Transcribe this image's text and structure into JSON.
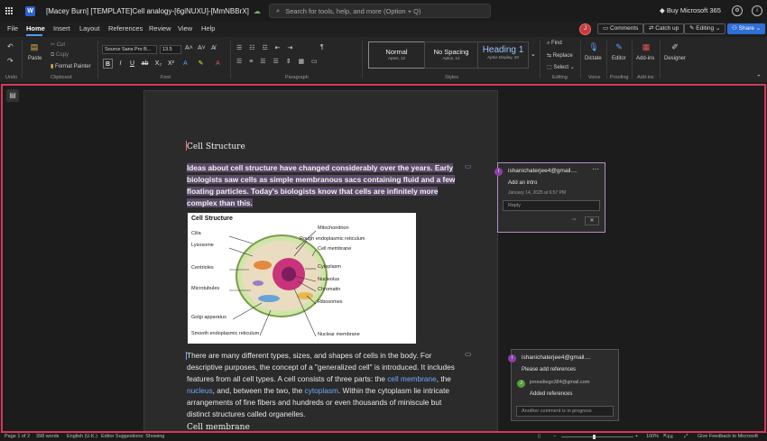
{
  "titlebar": {
    "doc_title": "[Macey Burn] [TEMPLATE]Cell analogy-[6giNUXU]-[MmNBBrX]",
    "search_placeholder": "Search for tools, help, and more (Option + Q)",
    "buy": "Buy Microsoft 365"
  },
  "menu": {
    "items": [
      "File",
      "Home",
      "Insert",
      "Layout",
      "References",
      "Review",
      "View",
      "Help"
    ],
    "active": "Home",
    "user_initial": "J",
    "comments": "Comments",
    "catchup": "Catch up",
    "editing": "Editing",
    "share": "Share"
  },
  "ribbon": {
    "undo_label": "Undo",
    "paste": "Paste",
    "cut": "Cut",
    "copy": "Copy",
    "format_painter": "Format Painter",
    "clipboard": "Clipboard",
    "font_name": "Source Sans Pro B...",
    "font_size": "13.5",
    "font_group": "Font",
    "paragraph_group": "Paragraph",
    "styles": [
      {
        "name": "Normal",
        "sub": "Aptos, 12"
      },
      {
        "name": "No Spacing",
        "sub": "Aptos, 12"
      },
      {
        "name": "Heading 1",
        "sub": "Aptos Display, 20"
      }
    ],
    "styles_group": "Styles",
    "find": "Find",
    "replace": "Replace",
    "select": "Select",
    "editing_group": "Editing",
    "dictate": "Dictate",
    "voice_group": "Voice",
    "editor": "Editor",
    "proofing_group": "Proofing",
    "addins": "Add-ins",
    "addins_group": "Add-ins",
    "designer": "Designer"
  },
  "document": {
    "heading1": "Cell Structure",
    "para1": "Ideas about cell structure have changed considerably over the years. Early biologists saw cells as simple membranous sacs containing fluid and a few floating particles. Today's biologists know that cells are infinitely more complex than this.",
    "figure_title": "Cell Structure",
    "figure_labels_left": [
      "Cilia",
      "Lysosome",
      "Centrioles",
      "Microtubules",
      "Golgi apparatus",
      "Smooth endoplasmic reticulum"
    ],
    "figure_labels_right": [
      "Mitochondrion",
      "Rough endoplasmic reticulum",
      "Cell membrane",
      "Cytoplasm",
      "Nucleolus",
      "Chromatin",
      "Ribosomes",
      "Nuclear membrane"
    ],
    "para2_a": "There are many different types, sizes, and shapes of cells in the body. For descriptive purposes, the concept of a \"generalized cell\" is introduced. It includes features from all cell types. A cell consists of three parts: the ",
    "para2_link1": "cell membrane",
    "para2_b": ", the ",
    "para2_link2": "nucleus",
    "para2_c": ", and, between the two, the ",
    "para2_link3": "cytoplasm",
    "para2_d": ". Within the cytoplasm lie intricate arrangements of fine fibers and hundreds or even thousands of miniscule but distinct structures called organelles.",
    "heading2": "Cell membrane"
  },
  "comments": [
    {
      "user": "ishanichaterjee4@gmail....",
      "initial": "I",
      "text": "Add an intro",
      "date": "January 14, 2025 at 6:57 PM",
      "reply_placeholder": "Reply"
    },
    {
      "user": "ishanichaterjee4@gmail....",
      "initial": "I",
      "text": "Please add references",
      "reply_user": "jonesdiego384@gmail.com",
      "reply_initial": "J",
      "reply_text": "Added references",
      "input_text": "Another comment is in progress"
    }
  ],
  "statusbar": {
    "page": "Page 1 of 2",
    "words": "398 words",
    "language": "English (U.K.)",
    "suggestions": "Editor Suggestions: Showing",
    "zoom": "100%",
    "fit": "Fit",
    "feedback": "Give Feedback to Microsoft"
  },
  "colors": {
    "accent": "#4f9bf5",
    "focus_border": "#d4395a",
    "comment_purple": "#8e3ea8"
  }
}
